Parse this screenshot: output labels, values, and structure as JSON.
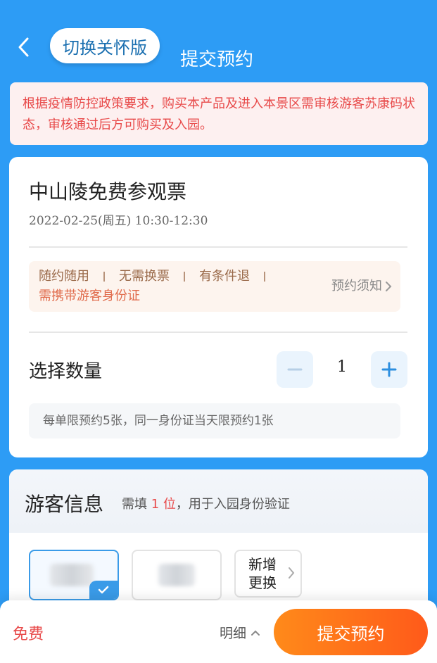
{
  "header": {
    "care_mode_label": "切换关怀版",
    "title": "提交预约"
  },
  "notice": {
    "text": "根据疫情防控政策要求，购买本产品及进入本景区需审核游客苏康码状态，审核通过后方可购买及入园。"
  },
  "ticket": {
    "name": "中山陵免费参观票",
    "date": "2022-02-25(周五) 10:30-12:30",
    "tags": [
      "随约随用",
      "无需换票",
      "有条件退"
    ],
    "requirement": "需携带游客身份证",
    "rules_link": "预约须知"
  },
  "quantity": {
    "label": "选择数量",
    "value": "1",
    "limit_note": "每单限预约5张，同一身份证当天限预约1张"
  },
  "visitor": {
    "title": "游客信息",
    "hint_prefix": "需填",
    "hint_count": "1 位",
    "hint_suffix": "，用于入园身份验证",
    "add_line1": "新增",
    "add_line2": "更换"
  },
  "footer": {
    "price": "免费",
    "detail_label": "明细",
    "submit_label": "提交预约"
  },
  "colors": {
    "primary_blue": "#2d9cf5",
    "alert_red": "#e84a4a",
    "submit_orange_start": "#ff8a1a",
    "submit_orange_end": "#ff5a1a"
  },
  "icons": {
    "back": "chevron-left-icon",
    "rules": "chevron-right-icon",
    "minus": "minus-icon",
    "plus": "plus-icon",
    "selected": "check-icon",
    "detail": "chevron-up-icon"
  }
}
